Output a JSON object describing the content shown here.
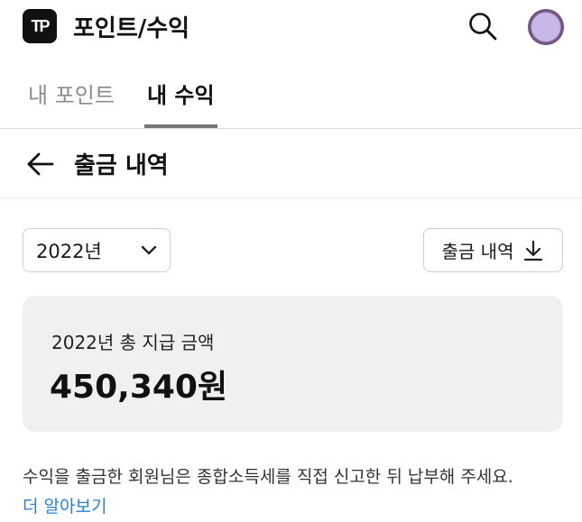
{
  "header": {
    "logo_text": "TP",
    "title": "포인트/수익",
    "icons": {
      "search": "search-icon",
      "avatar": "avatar"
    }
  },
  "tabs": [
    {
      "label": "내 포인트",
      "active": false
    },
    {
      "label": "내 수익",
      "active": true
    }
  ],
  "subheader": {
    "back_icon": "arrow-left-icon",
    "title": "출금 내역"
  },
  "filters": {
    "year_selected": "2022년",
    "year_icon": "chevron-down-icon",
    "download_label": "출금 내역",
    "download_icon": "download-icon"
  },
  "summary": {
    "label": "2022년 총 지급 금액",
    "amount": "450,340원"
  },
  "notice": {
    "text": "수익을 출금한 회원님은 종합소득세를 직접 신고한 뒤 납부해 주세요.",
    "link": "더 알아보기"
  },
  "colors": {
    "accent_link": "#2a7fd4",
    "card_bg": "#f0f0f0",
    "logo_bg": "#111111"
  }
}
